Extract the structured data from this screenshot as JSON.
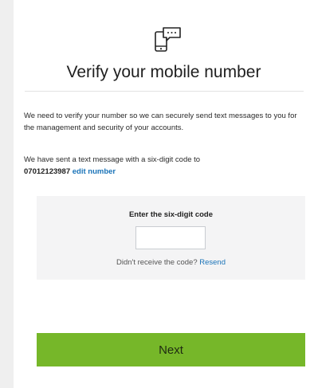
{
  "title": "Verify your mobile number",
  "intro": "We need to verify your number so we can securely send text messages to you for the management and security of your accounts.",
  "sent_message": "We have sent a text message with a six-digit code to",
  "phone_number": "07012123987",
  "edit_link": "edit number",
  "code_section": {
    "label": "Enter the six-digit code",
    "input_value": "",
    "input_placeholder": "",
    "resend_prompt": "Didn't receive the code?",
    "resend_link": "Resend"
  },
  "next_button": "Next",
  "icons": {
    "header": "phone-message-icon"
  },
  "colors": {
    "accent_green": "#76b729",
    "link_blue": "#1a73b8"
  }
}
